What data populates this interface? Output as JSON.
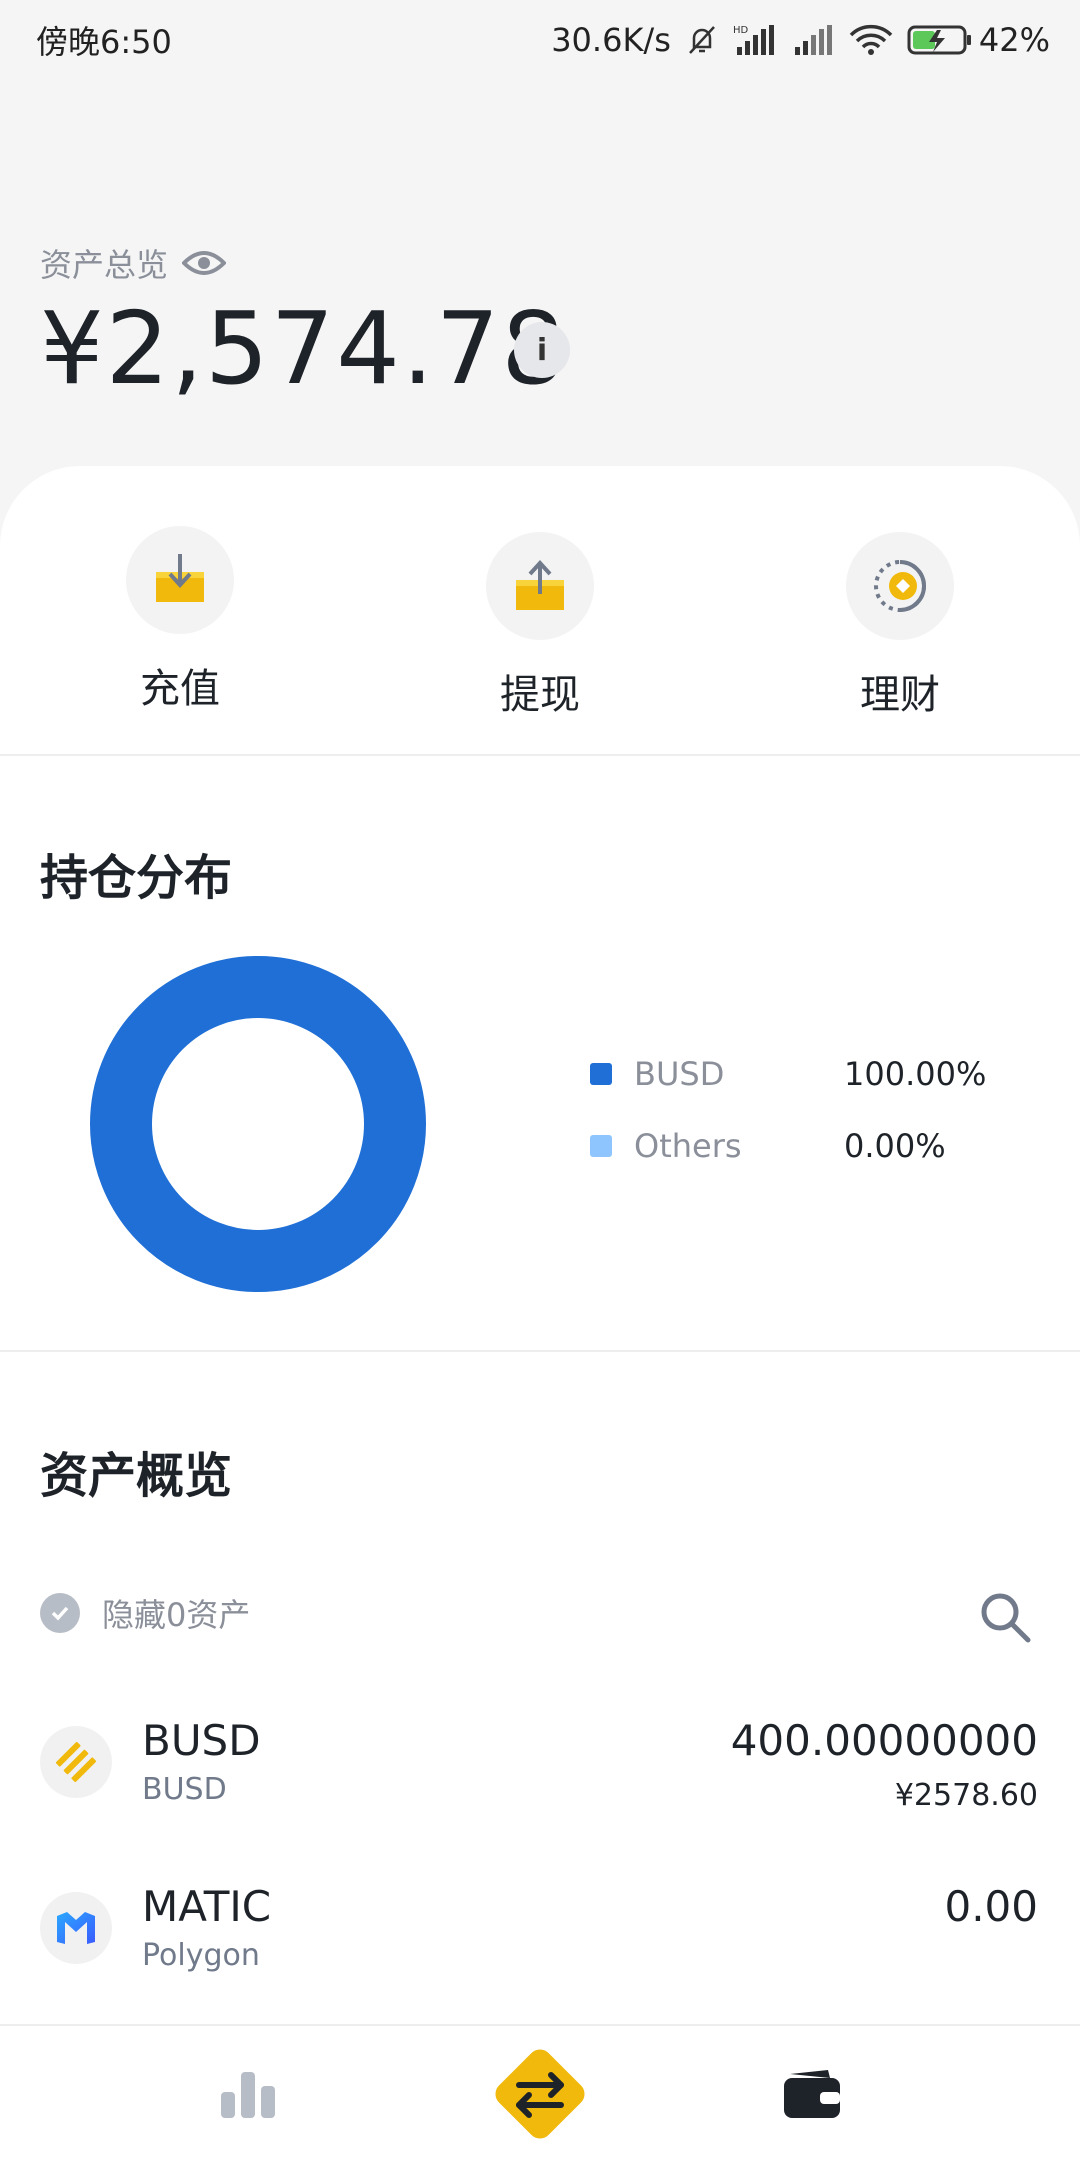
{
  "status_bar": {
    "time": "傍晚6:50",
    "net_speed": "30.6K/s",
    "battery": "42%"
  },
  "header": {
    "overview_label": "资产总览",
    "total_value": "¥2,574.78",
    "info_glyph": "i"
  },
  "actions": [
    {
      "label": "充值",
      "icon": "deposit-icon"
    },
    {
      "label": "提现",
      "icon": "withdraw-icon"
    },
    {
      "label": "理财",
      "icon": "earn-icon"
    }
  ],
  "holdings": {
    "title": "持仓分布"
  },
  "chart_data": {
    "type": "pie",
    "categories": [
      "BUSD",
      "Others"
    ],
    "values": [
      100.0,
      0.0
    ],
    "labels": [
      "100.00%",
      "0.00%"
    ],
    "colors": [
      "#1f6fd6",
      "#8ec5ff"
    ]
  },
  "assets_section": {
    "title": "资产概览",
    "hide_zero_label": "隐藏0资产"
  },
  "assets": [
    {
      "symbol": "BUSD",
      "name": "BUSD",
      "amount": "400.00000000",
      "fiat": "¥2578.60",
      "icon": "busd-logo-icon"
    },
    {
      "symbol": "MATIC",
      "name": "Polygon",
      "amount": "0.00",
      "fiat": "",
      "icon": "polygon-logo-icon"
    }
  ],
  "colors": {
    "brand_yellow": "#f0b90b",
    "donut_primary": "#1f6fd6",
    "donut_secondary": "#8ec5ff",
    "text_primary": "#1e2329",
    "text_secondary": "#8a8f99"
  }
}
